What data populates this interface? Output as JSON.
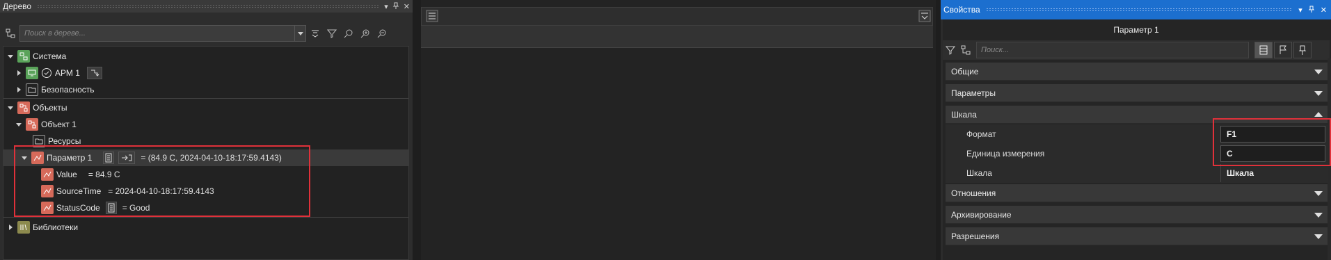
{
  "tree_panel": {
    "title": "Дерево",
    "search_placeholder": "Поиск в дереве...",
    "nodes": {
      "system": "Система",
      "arm": "АРМ 1",
      "security": "Безопасность",
      "objects": "Объекты",
      "object1": "Объект 1",
      "resources": "Ресурсы",
      "param1": "Параметр 1",
      "param1_value": "=  (84.9 C, 2024-04-10-18:17:59.4143)",
      "value": "Value",
      "value_val": "=  84.9 C",
      "sourcetime": "SourceTime",
      "sourcetime_val": "=  2024-04-10-18:17:59.4143",
      "statuscode": "StatusCode",
      "statuscode_val": "=  Good",
      "libraries": "Библиотеки"
    }
  },
  "props_panel": {
    "title": "Свойства",
    "object_name": "Параметр 1",
    "search_placeholder": "Поиск...",
    "categories": {
      "general": "Общие",
      "parameters": "Параметры",
      "scale": "Шкала",
      "relations": "Отношения",
      "archiving": "Архивирование",
      "permissions": "Разрешения"
    },
    "properties": {
      "format_label": "Формат",
      "format_value": "F1",
      "unit_label": "Единица измерения",
      "unit_value": "C",
      "scale_label": "Шкала",
      "scale_value": "Шкала"
    }
  },
  "colors": {
    "accent": "#1c6fcf",
    "highlight_box": "#e0313a",
    "node_green": "#5aa35a",
    "node_red": "#d66a5a"
  }
}
